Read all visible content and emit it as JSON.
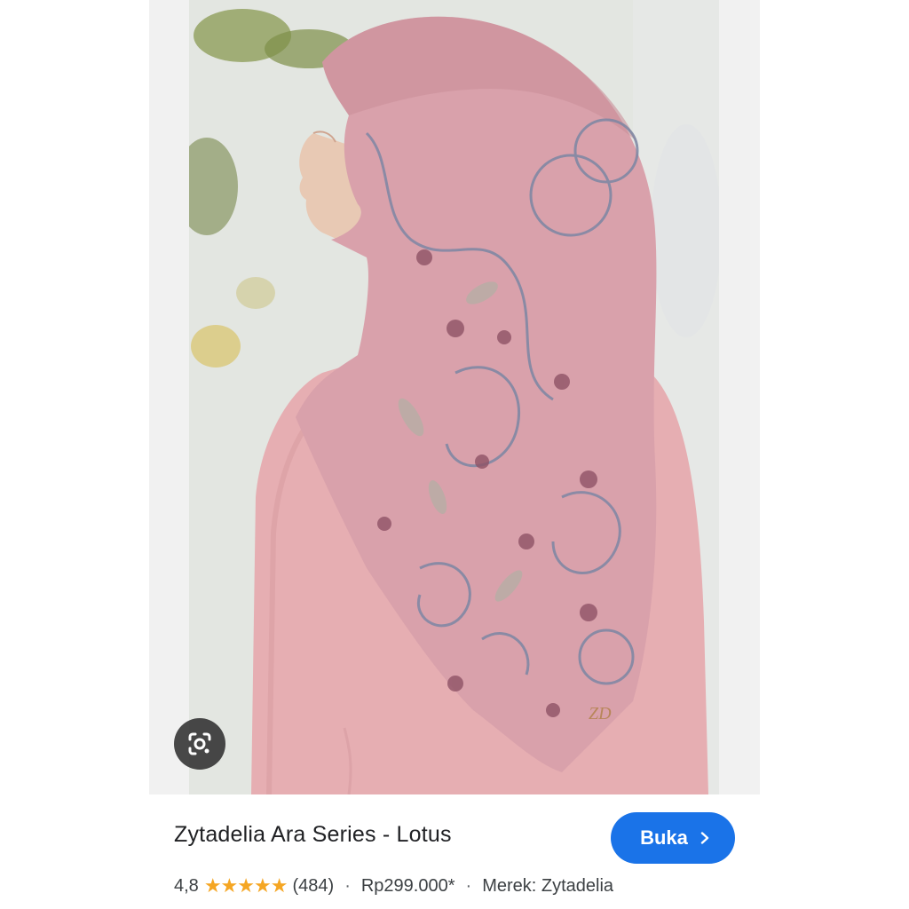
{
  "product": {
    "title": "Zytadelia Ara Series - Lotus",
    "rating": "4,8",
    "star_count": 5,
    "review_count": "(484)",
    "price": "Rp299.000*",
    "brand": "Merek: Zytadelia"
  },
  "actions": {
    "open_label": "Buka",
    "open_icon": "chevron-right-icon",
    "lens_icon": "google-lens-icon"
  },
  "separators": {
    "dot": "·"
  },
  "colors": {
    "accent": "#1a73e8",
    "star": "#f5a623",
    "hijab": "#d9a1ab",
    "dress": "#e6aeb2"
  }
}
